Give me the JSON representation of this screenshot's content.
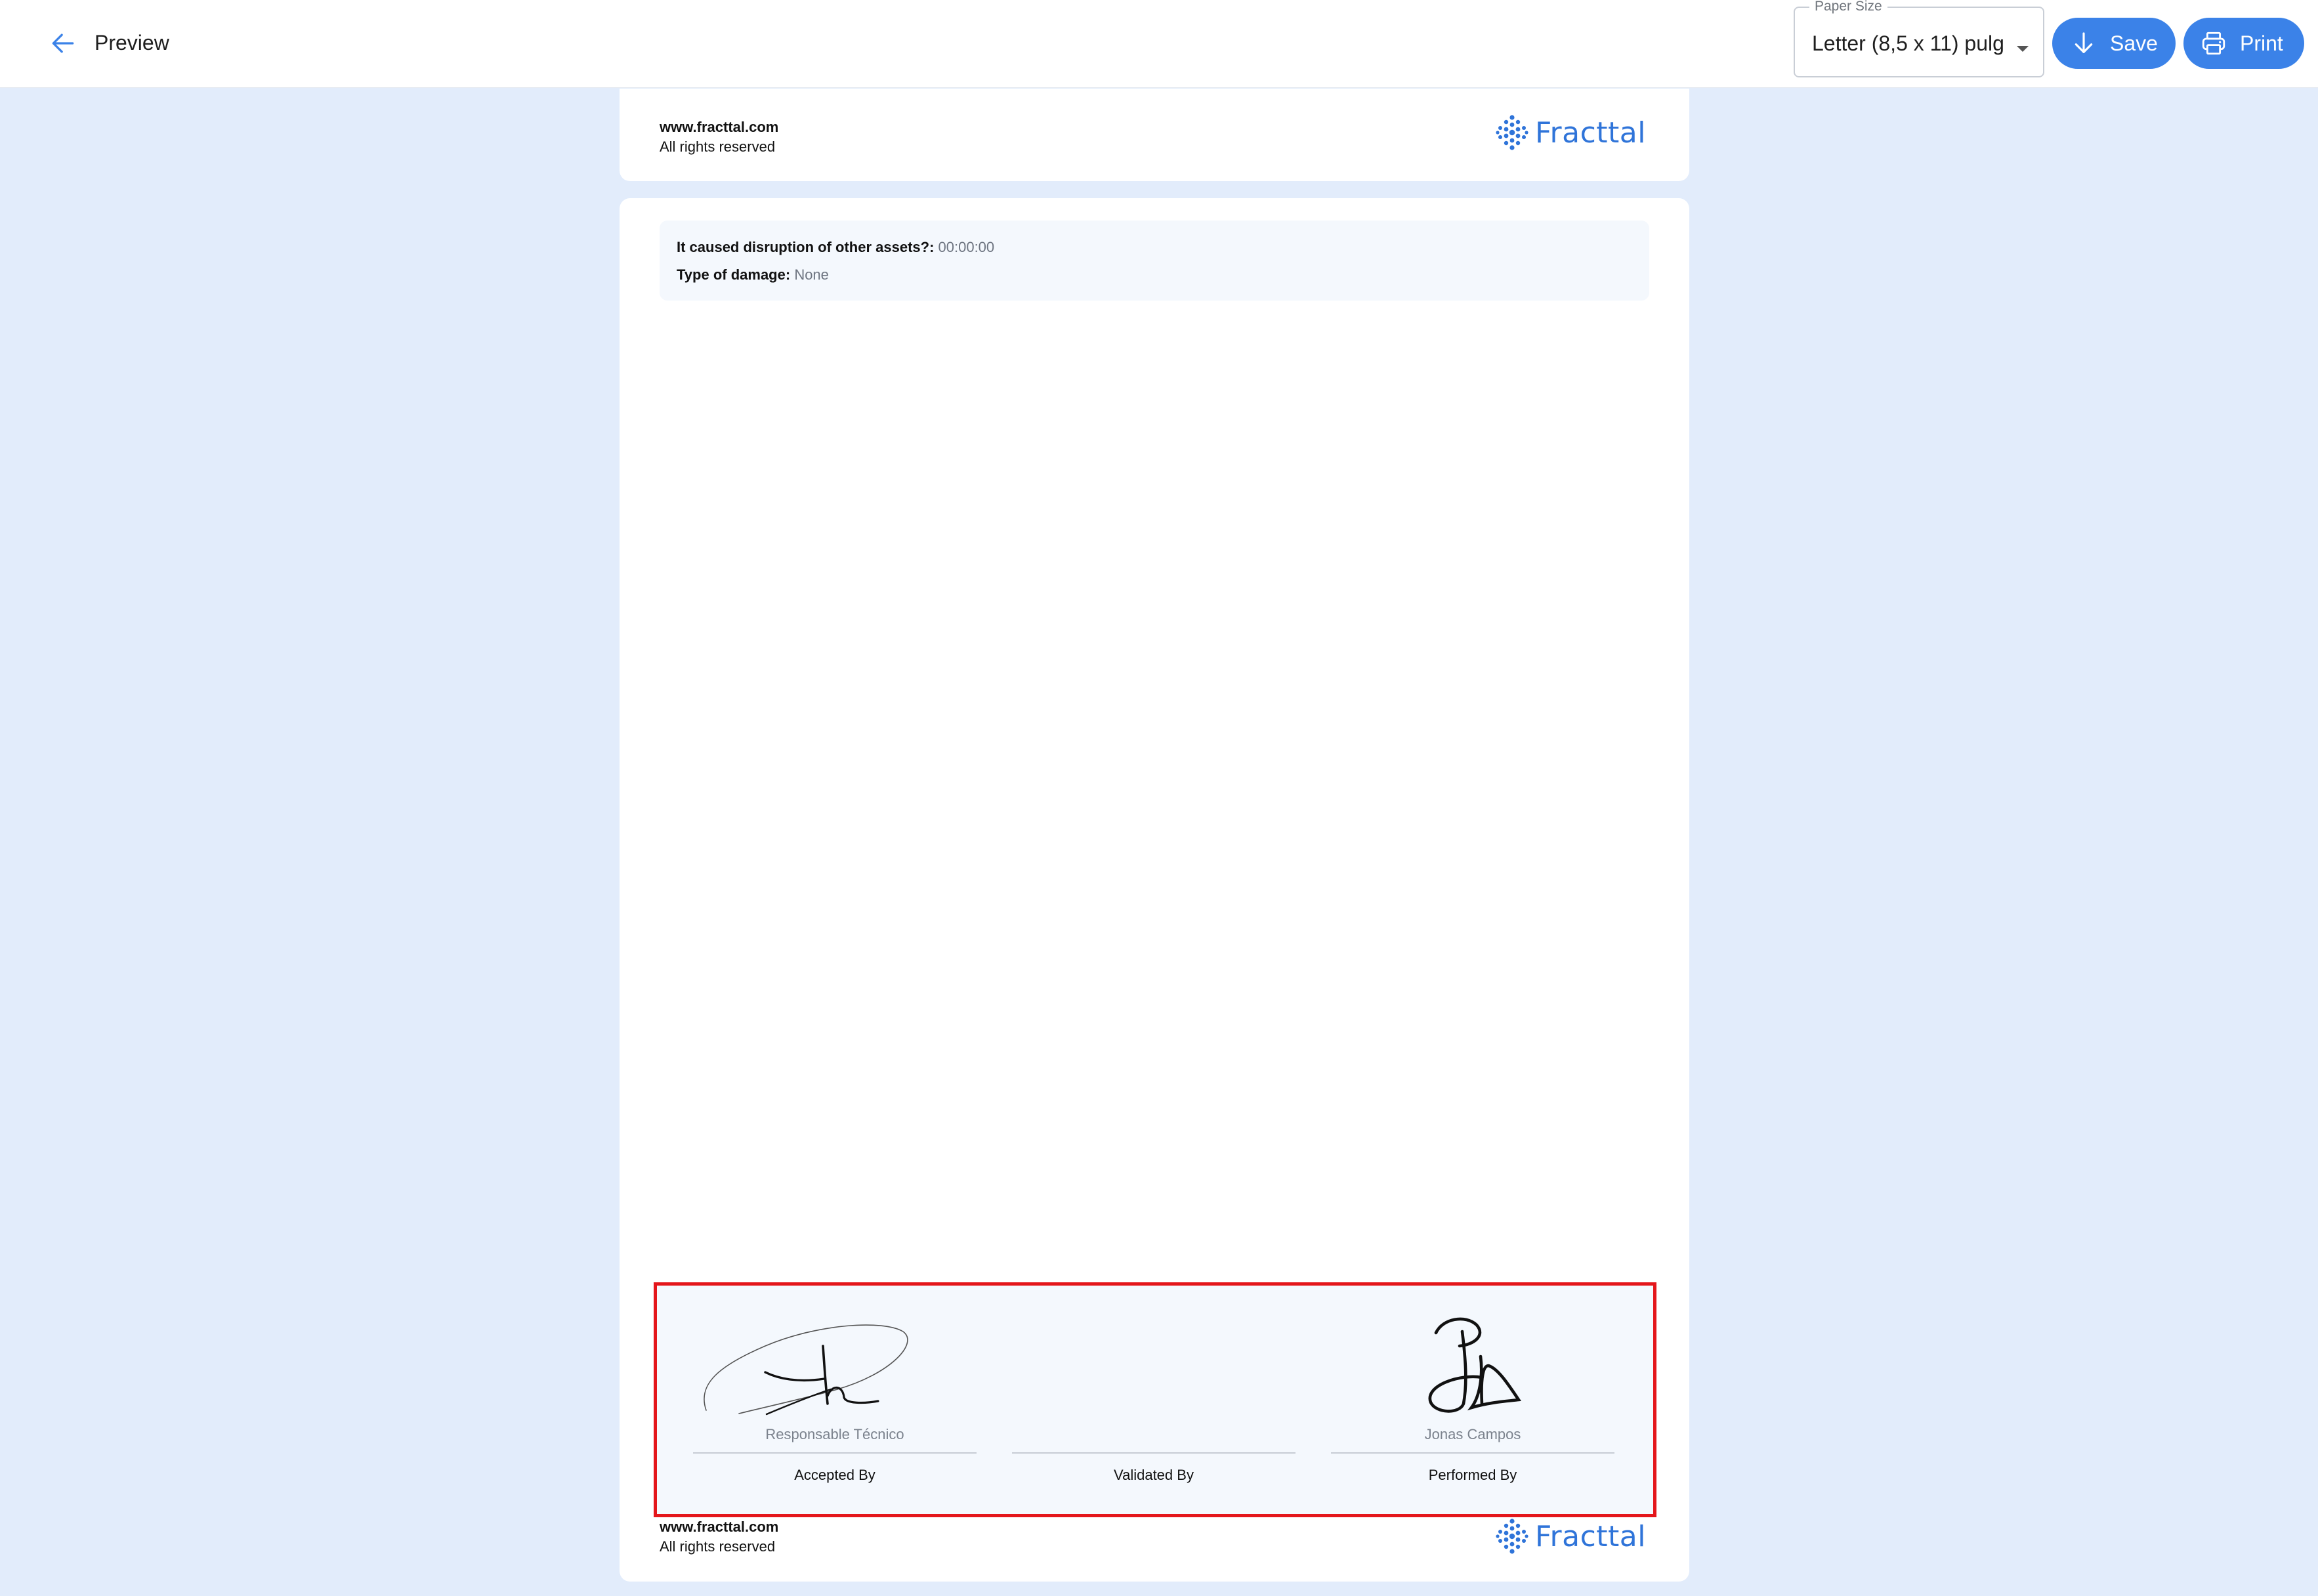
{
  "header": {
    "title": "Preview",
    "paper_size": {
      "label": "Paper Size",
      "value": "Letter (8,5 x 11) pulg"
    },
    "save_label": "Save",
    "print_label": "Print"
  },
  "page_footer": {
    "site": "www.fracttal.com",
    "rights": "All rights reserved",
    "logo_text": "Fracttal"
  },
  "details": [
    {
      "label": "It caused disruption of other assets?:",
      "value": "00:00:00"
    },
    {
      "label": "Type of damage:",
      "value": "None"
    }
  ],
  "signatures": [
    {
      "name": "Responsable Técnico",
      "role": "Accepted By",
      "signed": true
    },
    {
      "name": "",
      "role": "Validated By",
      "signed": false
    },
    {
      "name": "Jonas Campos",
      "role": "Performed By",
      "signed": true
    }
  ],
  "colors": {
    "accent": "#3b82e8",
    "background": "#e2ecfb",
    "highlight": "#e4161b"
  }
}
